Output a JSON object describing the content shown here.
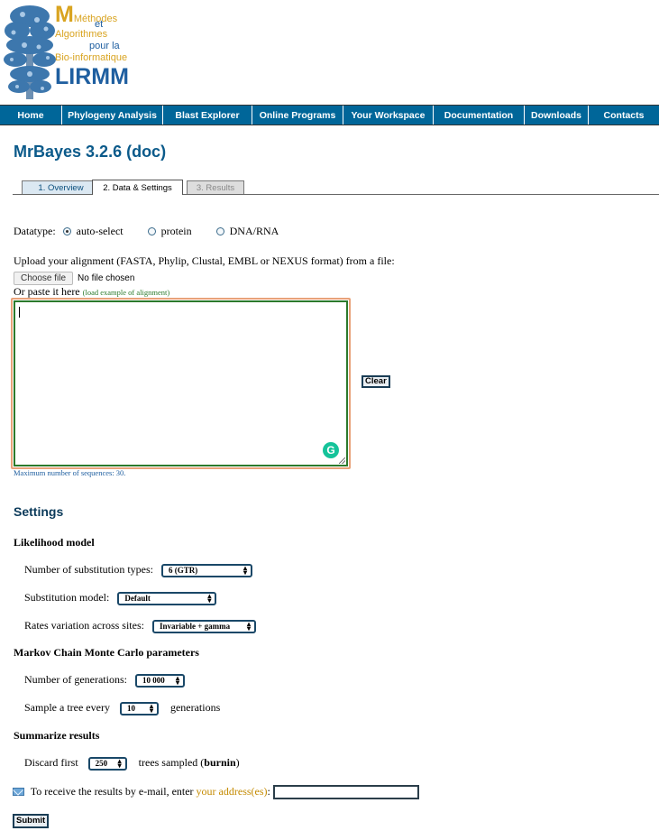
{
  "logo": {
    "line1": "Méthodes",
    "line2": "et",
    "line3": "Algorithmes",
    "line4": "pour la",
    "line5": "Bio-informatique",
    "line6": "LIRMM",
    "colors": {
      "gold": "#d9a421",
      "blue": "#1f5fa0"
    }
  },
  "nav": [
    "Home",
    "Phylogeny Analysis",
    "Blast Explorer",
    "Online Programs",
    "Your Workspace",
    "Documentation",
    "Downloads",
    "Contacts"
  ],
  "page_title": "MrBayes 3.2.6 (doc)",
  "tabs": [
    "1. Overview",
    "2. Data & Settings",
    "3. Results"
  ],
  "datatype": {
    "label": "Datatype:",
    "options": [
      "auto-select",
      "protein",
      "DNA/RNA"
    ],
    "selected": "auto-select"
  },
  "upload": {
    "label": "Upload your alignment (FASTA, Phylip, Clustal, EMBL or NEXUS format) from a file:",
    "choose_button": "Choose file",
    "file_status": "No file chosen",
    "paste_label": "Or paste it here",
    "example_link": "(load example of alignment)",
    "textarea_value": "",
    "clear_button": "Clear",
    "max_note": "Maximum number of sequences: 30."
  },
  "settings": {
    "heading": "Settings",
    "likelihood": {
      "heading": "Likelihood model",
      "subst_types_label": "Number of substitution types:",
      "subst_types_value": "6 (GTR)",
      "subst_model_label": "Substitution model:",
      "subst_model_value": "Default",
      "rates_label": "Rates variation across sites:",
      "rates_value": "Invariable + gamma"
    },
    "mcmc": {
      "heading": "Markov Chain Monte Carlo parameters",
      "generations_label": "Number of generations:",
      "generations_value": "10 000",
      "sample_prefix": "Sample a tree every",
      "sample_value": "10",
      "sample_suffix": "generations"
    },
    "summarize": {
      "heading": "Summarize results",
      "discard_prefix": "Discard first",
      "discard_value": "250",
      "discard_suffix": "trees sampled (",
      "burnin": "burnin",
      "close_paren": ")"
    }
  },
  "email": {
    "prefix": "To receive the results by e-mail, enter",
    "link": "your address(es)",
    "colon": ":",
    "value": ""
  },
  "submit_button": "Submit"
}
